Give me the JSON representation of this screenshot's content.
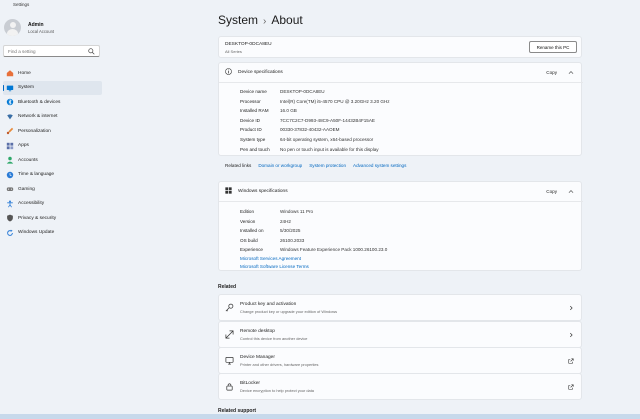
{
  "window": {
    "title": "Settings"
  },
  "profile": {
    "name": "Admin",
    "subtitle": "Local Account"
  },
  "search": {
    "placeholder": "Find a setting"
  },
  "sidebar": {
    "items": [
      {
        "label": "Home",
        "icon": "home-icon",
        "color": "#e8703a"
      },
      {
        "label": "System",
        "icon": "system-icon",
        "color": "#0078d4",
        "active": true
      },
      {
        "label": "Bluetooth & devices",
        "icon": "bluetooth-icon",
        "color": "#0078d4"
      },
      {
        "label": "Network & internet",
        "icon": "network-icon",
        "color": "#3a6ea5"
      },
      {
        "label": "Personalization",
        "icon": "brush-icon",
        "color": "#e88a3a"
      },
      {
        "label": "Apps",
        "icon": "apps-icon",
        "color": "#5a6fa8"
      },
      {
        "label": "Accounts",
        "icon": "accounts-icon",
        "color": "#2ea86a"
      },
      {
        "label": "Time & language",
        "icon": "time-icon",
        "color": "#2a7bd6"
      },
      {
        "label": "Gaming",
        "icon": "gaming-icon",
        "color": "#777777"
      },
      {
        "label": "Accessibility",
        "icon": "accessibility-icon",
        "color": "#2a7bd6"
      },
      {
        "label": "Privacy & security",
        "icon": "shield-icon",
        "color": "#555555"
      },
      {
        "label": "Windows Update",
        "icon": "update-icon",
        "color": "#2a7bd6"
      }
    ]
  },
  "header": {
    "section": "System",
    "page": "About"
  },
  "pc": {
    "name": "DESKTOP-0DCA8EU",
    "model": "All Series",
    "rename_label": "Rename this PC"
  },
  "device_specs": {
    "title": "Device specifications",
    "copy_label": "Copy",
    "rows": [
      {
        "k": "Device name",
        "v": "DESKTOP-0DCA8EU"
      },
      {
        "k": "Processor",
        "v": "Intel(R) Core(TM) i5-4570 CPU @ 3.20GHz   3.20 GHz"
      },
      {
        "k": "Installed RAM",
        "v": "16.0 GB"
      },
      {
        "k": "Device ID",
        "v": "7CC7C2C7-D993-48C9-A50F-14432B4F15AE"
      },
      {
        "k": "Product ID",
        "v": "00330-37832-40432-AAOEM"
      },
      {
        "k": "System type",
        "v": "64-bit operating system, x64-based processor"
      },
      {
        "k": "Pen and touch",
        "v": "No pen or touch input is available for this display"
      }
    ]
  },
  "related_links": {
    "label": "Related links",
    "links": [
      "Domain or workgroup",
      "System protection",
      "Advanced system settings"
    ]
  },
  "windows_specs": {
    "title": "Windows specifications",
    "copy_label": "Copy",
    "rows": [
      {
        "k": "Edition",
        "v": "Windows 11 Pro"
      },
      {
        "k": "Version",
        "v": "24H2"
      },
      {
        "k": "Installed on",
        "v": "5/30/2025"
      },
      {
        "k": "OS build",
        "v": "26100.2033"
      },
      {
        "k": "Experience",
        "v": "Windows Feature Experience Pack 1000.26100.23.0"
      }
    ],
    "links": [
      "Microsoft Services Agreement",
      "Microsoft Software License Terms"
    ]
  },
  "related": {
    "heading": "Related",
    "items": [
      {
        "title": "Product key and activation",
        "desc": "Change product key or upgrade your edition of Windows",
        "icon": "key-icon",
        "arrow": "chevron-right-icon"
      },
      {
        "title": "Remote desktop",
        "desc": "Control this device from another device",
        "icon": "remote-desktop-icon",
        "arrow": "chevron-right-icon"
      },
      {
        "title": "Device Manager",
        "desc": "Printer and other drivers, hardware properties",
        "icon": "device-manager-icon",
        "arrow": "external-link-icon"
      },
      {
        "title": "BitLocker",
        "desc": "Device encryption to help protect your data",
        "icon": "bitlocker-icon",
        "arrow": "external-link-icon"
      }
    ]
  },
  "related_support": {
    "heading": "Related support"
  }
}
